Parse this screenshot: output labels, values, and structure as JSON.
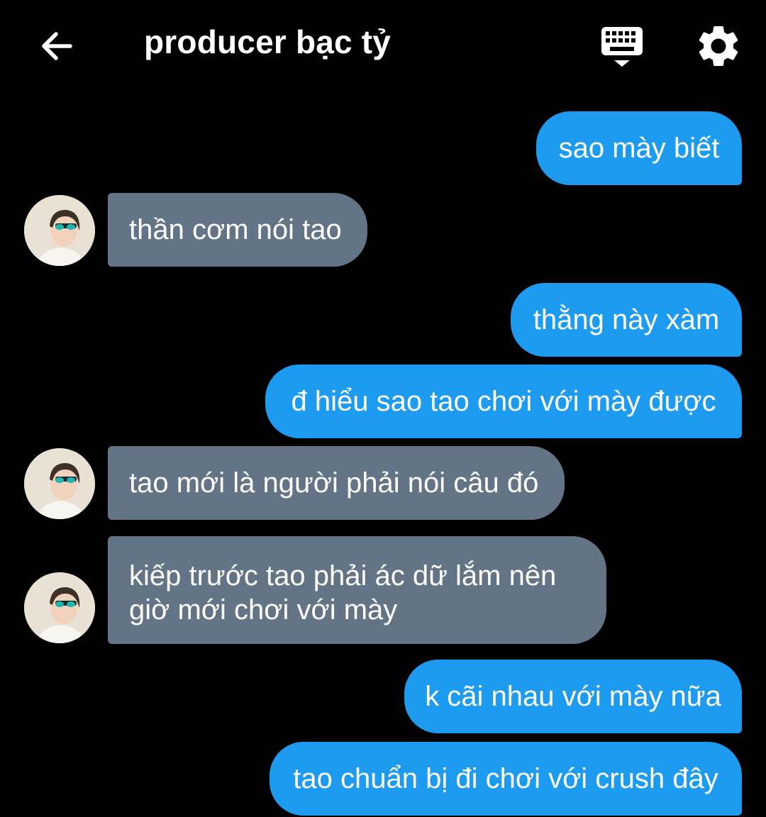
{
  "header": {
    "title": "producer bạc tỷ",
    "back_icon": "back-arrow-icon",
    "keyboard_icon": "keyboard-icon",
    "settings_icon": "gear-icon"
  },
  "colors": {
    "background": "#000000",
    "outgoing_bubble": "#1d9bf0",
    "incoming_bubble": "#637486",
    "text": "#ffffff"
  },
  "messages": [
    {
      "direction": "outgoing",
      "text": "sao mày biết"
    },
    {
      "direction": "incoming",
      "text": "thần cơm nói tao"
    },
    {
      "direction": "outgoing",
      "text": "thằng này xàm"
    },
    {
      "direction": "outgoing",
      "text": "đ hiểu sao tao chơi với mày được"
    },
    {
      "direction": "incoming",
      "text": "tao mới là người phải nói câu đó"
    },
    {
      "direction": "incoming",
      "lines": [
        "kiếp trước tao phải ác dữ lắm nên",
        "giờ mới chơi với mày"
      ]
    },
    {
      "direction": "outgoing",
      "text": "k cãi nhau với mày nữa"
    },
    {
      "direction": "outgoing",
      "text": "tao chuẩn bị đi chơi với crush đây"
    }
  ]
}
